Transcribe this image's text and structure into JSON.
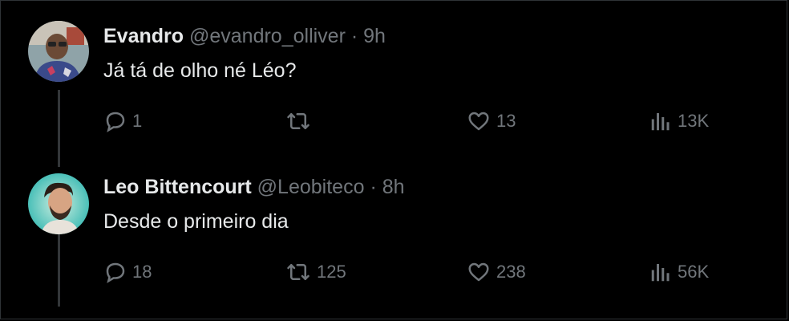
{
  "tweets": [
    {
      "name": "Evandro",
      "handle": "@evandro_olliver",
      "dot": "·",
      "time": "9h",
      "text": "Já tá de olho né Léo?",
      "replies": "1",
      "retweets": "",
      "likes": "13",
      "views": "13K"
    },
    {
      "name": "Leo Bittencourt",
      "handle": "@Leobiteco",
      "dot": "·",
      "time": "8h",
      "text": "Desde o primeiro dia",
      "replies": "18",
      "retweets": "125",
      "likes": "238",
      "views": "56K"
    }
  ],
  "icons": {
    "reply": "reply-icon",
    "retweet": "retweet-icon",
    "like": "heart-icon",
    "views": "views-icon"
  },
  "colors": {
    "background": "#000000",
    "text": "#e7e9ea",
    "secondary": "#71767b",
    "thread_line": "#333639"
  }
}
